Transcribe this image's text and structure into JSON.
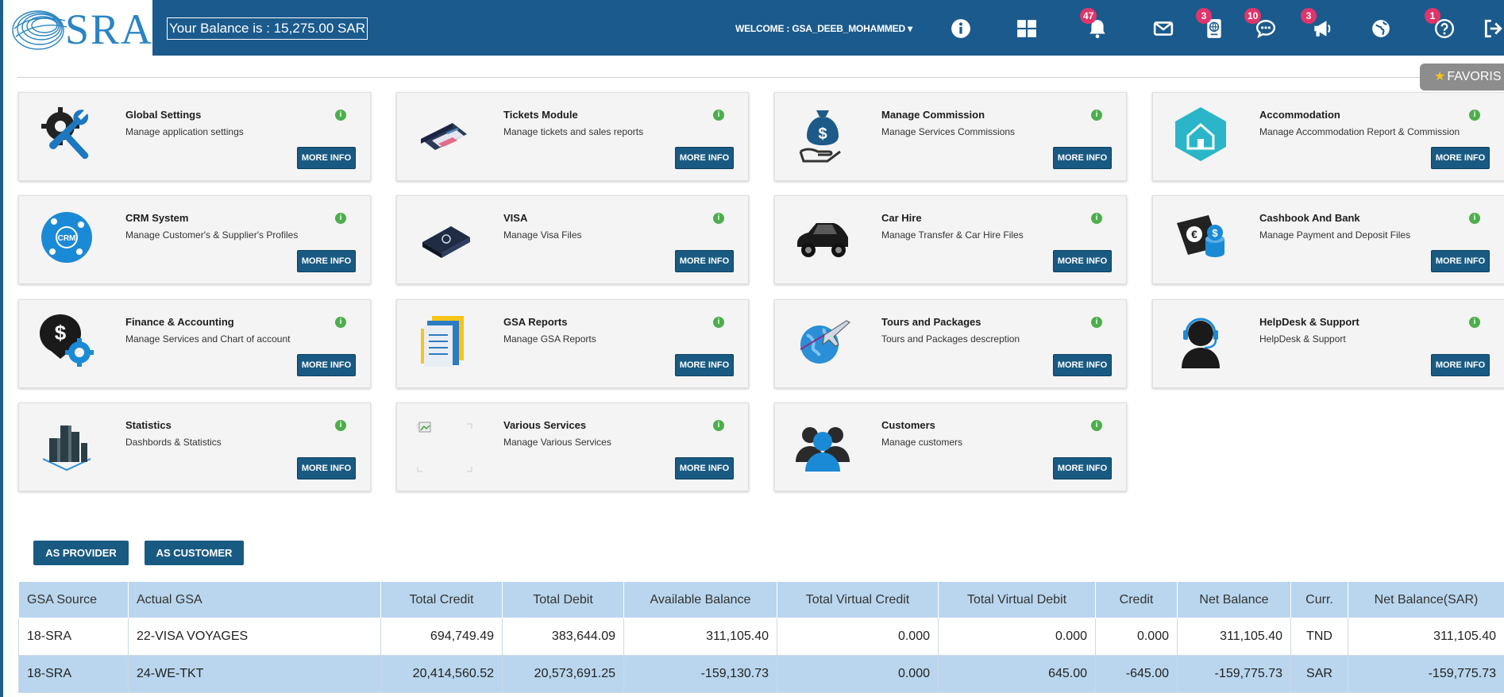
{
  "header": {
    "logo_text": "SRA",
    "balance": "Your Balance is : 15,275.00 SAR",
    "welcome": "WELCOME : GSA_DEEB_MOHAMMED",
    "badges": {
      "notifications": "47",
      "passport": "3",
      "chat": "10",
      "announce": "3",
      "help": "1"
    }
  },
  "side": {
    "favoris": "FAVORIS"
  },
  "cards": [
    {
      "title": "Global Settings",
      "desc": "Manage application settings",
      "btn": "MORE INFO",
      "icon": "settings-tools-icon"
    },
    {
      "title": "Tickets Module",
      "desc": "Manage tickets and sales reports",
      "btn": "MORE INFO",
      "icon": "tickets-icon"
    },
    {
      "title": "Manage Commission",
      "desc": "Manage Services Commissions",
      "btn": "MORE INFO",
      "icon": "money-bag-icon"
    },
    {
      "title": "Accommodation",
      "desc": "Manage Accommodation Report & Commission",
      "btn": "MORE INFO",
      "icon": "house-icon"
    },
    {
      "title": "CRM System",
      "desc": "Manage Customer's & Supplier's Profiles",
      "btn": "MORE INFO",
      "icon": "crm-icon",
      "icon_text": "CRM"
    },
    {
      "title": "VISA",
      "desc": "Manage Visa Files",
      "btn": "MORE INFO",
      "icon": "passport-icon"
    },
    {
      "title": "Car Hire",
      "desc": "Manage Transfer & Car Hire Files",
      "btn": "MORE INFO",
      "icon": "car-icon"
    },
    {
      "title": "Cashbook And Bank",
      "desc": "Manage Payment and Deposit Files",
      "btn": "MORE INFO",
      "icon": "cashbook-icon"
    },
    {
      "title": "Finance & Accounting",
      "desc": "Manage Services and Chart of account",
      "btn": "MORE INFO",
      "icon": "finance-icon"
    },
    {
      "title": "GSA Reports",
      "desc": "Manage GSA Reports",
      "btn": "MORE INFO",
      "icon": "reports-icon"
    },
    {
      "title": "Tours and Packages",
      "desc": "Tours and Packages descreption",
      "btn": "MORE INFO",
      "icon": "globe-plane-icon"
    },
    {
      "title": "HelpDesk & Support",
      "desc": "HelpDesk & Support",
      "btn": "MORE INFO",
      "icon": "helpdesk-icon"
    },
    {
      "title": "Statistics",
      "desc": "Dashbords & Statistics",
      "btn": "MORE INFO",
      "icon": "statistics-icon"
    },
    {
      "title": "Various Services",
      "desc": "Manage Various Services",
      "btn": "MORE INFO",
      "icon": "broken-image-icon"
    },
    {
      "title": "Customers",
      "desc": "Manage customers",
      "btn": "MORE INFO",
      "icon": "customers-icon"
    }
  ],
  "tabs": {
    "provider": "AS PROVIDER",
    "customer": "AS CUSTOMER"
  },
  "table": {
    "headers": [
      "GSA Source",
      "Actual GSA",
      "Total Credit",
      "Total Debit",
      "Available Balance",
      "Total Virtual Credit",
      "Total Virtual Debit",
      "Credit",
      "Net Balance",
      "Curr.",
      "Net Balance(SAR)"
    ],
    "rows": [
      [
        "18-SRA",
        "22-VISA VOYAGES",
        "694,749.49",
        "383,644.09",
        "311,105.40",
        "0.000",
        "0.000",
        "0.000",
        "311,105.40",
        "TND",
        "311,105.40"
      ],
      [
        "18-SRA",
        "24-WE-TKT",
        "20,414,560.52",
        "20,573,691.25",
        "-159,130.73",
        "0.000",
        "645.00",
        "-645.00",
        "-159,775.73",
        "SAR",
        "-159,775.73"
      ]
    ]
  }
}
